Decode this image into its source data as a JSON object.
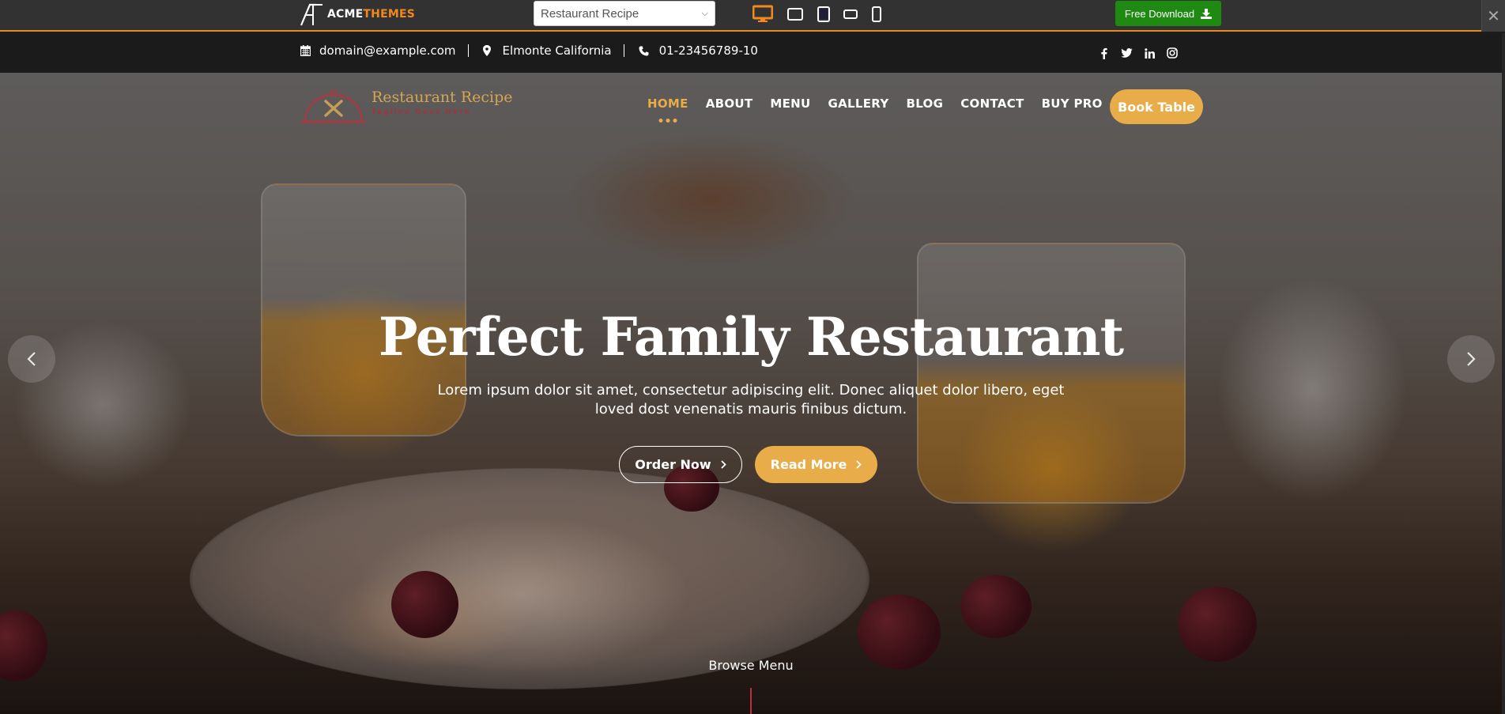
{
  "preview_bar": {
    "brand": {
      "part1": "ACME",
      "part2": "THEMES"
    },
    "theme_select": {
      "value": "Restaurant Recipe"
    },
    "devices": [
      {
        "name": "desktop",
        "active": true
      },
      {
        "name": "tablet-landscape",
        "active": false
      },
      {
        "name": "tablet-portrait",
        "active": false
      },
      {
        "name": "mobile-landscape",
        "active": false
      },
      {
        "name": "mobile-portrait",
        "active": false
      }
    ],
    "download_label": "Free Download",
    "close_label": "✕",
    "colors": {
      "accent": "#e8891c",
      "download_bg": "#1e8a12"
    }
  },
  "info_bar": {
    "email": "domain@example.com",
    "location": "Elmonte California",
    "phone": "01-23456789-10",
    "social": [
      "facebook",
      "twitter",
      "linkedin",
      "instagram"
    ]
  },
  "header": {
    "site_title": "Restaurant Recipe",
    "tagline": "Tagline Goes Here",
    "nav": [
      {
        "label": "HOME",
        "active": true
      },
      {
        "label": "ABOUT",
        "active": false
      },
      {
        "label": "MENU",
        "active": false
      },
      {
        "label": "GALLERY",
        "active": false
      },
      {
        "label": "BLOG",
        "active": false
      },
      {
        "label": "CONTACT",
        "active": false
      },
      {
        "label": "BUY PRO",
        "active": false
      }
    ],
    "book_button": "Book Table",
    "colors": {
      "primary": "#e8ac48",
      "secondary": "#b8323e"
    }
  },
  "slider": {
    "title": "Perfect Family Restaurant",
    "description": "Lorem ipsum dolor sit amet, consectetur adipiscing elit. Donec aliquet dolor libero, eget loved dost venenatis mauris finibus dictum.",
    "primary_button": "Order Now",
    "secondary_button": "Read More",
    "prev_label": "‹",
    "next_label": "›",
    "browse_label": "Browse Menu"
  }
}
